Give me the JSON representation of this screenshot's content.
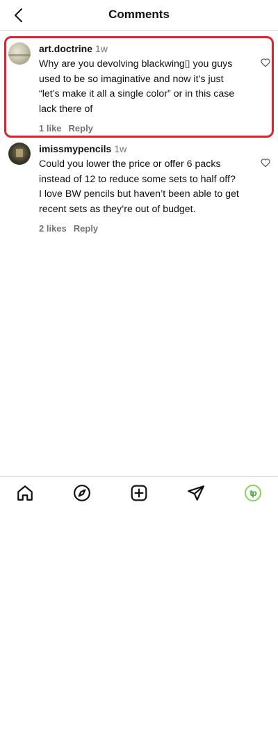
{
  "header": {
    "title": "Comments"
  },
  "comments": [
    {
      "username": "art.doctrine",
      "time": "1w",
      "text": "Why are you devolving blackwing▯ you guys used to be so imaginative and now it’s just “let’s make it all a single color” or in this case lack there of",
      "likes": "1 like",
      "reply": "Reply"
    },
    {
      "username": "imissmypencils",
      "time": "1w",
      "text": "Could you lower the price or offer 6 packs instead of 12 to reduce some sets to half off? I love BW pencils but haven’t been able to get recent sets as they’re out of budget.",
      "likes": "2 likes",
      "reply": "Reply"
    }
  ],
  "tabbar": {
    "items": [
      "home-icon",
      "explore-icon",
      "create-icon",
      "direct-icon",
      "profile-avatar"
    ],
    "profile_initials": "tp"
  },
  "colors": {
    "highlight": "#e0212e",
    "profile_ring": "#7ed957",
    "meta_text": "#737373"
  }
}
